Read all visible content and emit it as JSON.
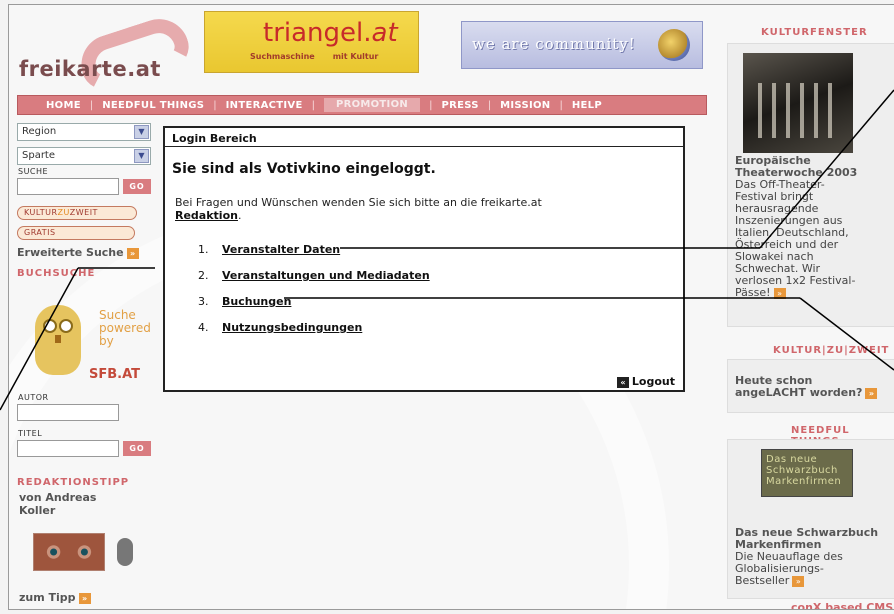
{
  "logo": {
    "text": "freikarte",
    "suffix": ".at"
  },
  "banner_triangel": {
    "brand": "triangel.",
    "brand_tld": "at",
    "sub1": "Suchmaschine",
    "sub2": "mit Kultur"
  },
  "banner_community": {
    "text": "we are community!"
  },
  "nav": {
    "items": [
      "HOME",
      "NEEDFUL THINGS",
      "INTERACTIVE",
      "PROMOTION",
      "PRESS",
      "MISSION",
      "HELP"
    ],
    "active": "PROMOTION"
  },
  "sidebar": {
    "region": "Region",
    "sparte": "Sparte",
    "suche_label": "SUCHE",
    "go": "GO",
    "kultur_prefix": "KULTUR",
    "kultur_zu": "ZU",
    "kultur_suffix": "ZWEIT",
    "gratis": "GRATIS",
    "erweiterte": "Erweiterte Suche",
    "buchsuche": "BUCHSUCHE",
    "owl_line1": "Suche",
    "owl_line2": "powered",
    "owl_line3": "by",
    "sfb": "SFB.AT",
    "autor_label": "AUTOR",
    "titel_label": "TITEL",
    "redaktionstipp": "REDAKTIONSTIPP",
    "author_line1": "von Andreas",
    "author_line2": "Koller",
    "zum_tipp": "zum Tipp"
  },
  "dialog": {
    "title": "Login Bereich",
    "heading": "Sie sind als Votivkino eingeloggt.",
    "text": "Bei Fragen und Wünschen wenden Sie sich bitte an die freikarte.at",
    "text_link": "Redaktion",
    "text_end": ".",
    "items": [
      {
        "num": "1.",
        "label": "Veranstalter Daten"
      },
      {
        "num": "2.",
        "label": "Veranstaltungen und Mediadaten"
      },
      {
        "num": "3.",
        "label": "Buchungen"
      },
      {
        "num": "4.",
        "label": "Nutzungsbedingungen"
      }
    ],
    "logout": "Logout"
  },
  "right": {
    "kulturfenster": "KULTURFENSTER",
    "event_title1": "Europäische",
    "event_title2": "Theaterwoche 2003",
    "event_lines": [
      "Das Off-Theater-",
      "Festival bringt",
      "herausragende",
      "Inszenierungen aus",
      "Italien, Deutschland,",
      "Österreich und der",
      "Slowakei nach",
      "Schwechat. Wir",
      "verlosen 1x2 Festival-",
      "Pässe!"
    ],
    "kulturzuzweit": "KULTUR|ZU|ZWEIT",
    "heute1": "Heute schon",
    "heute2": "angeLACHT worden?",
    "needful": "NEEDFUL THINGS",
    "book_text": "Das neue Schwarzbuch Markenfirmen",
    "book_title1": "Das neue Schwarzbuch",
    "book_title2": "Markenfirmen",
    "book_lines": [
      "Die Neuauflage des",
      "Globalisierungs-",
      "Bestseller"
    ],
    "footer": "conX based CMS"
  }
}
